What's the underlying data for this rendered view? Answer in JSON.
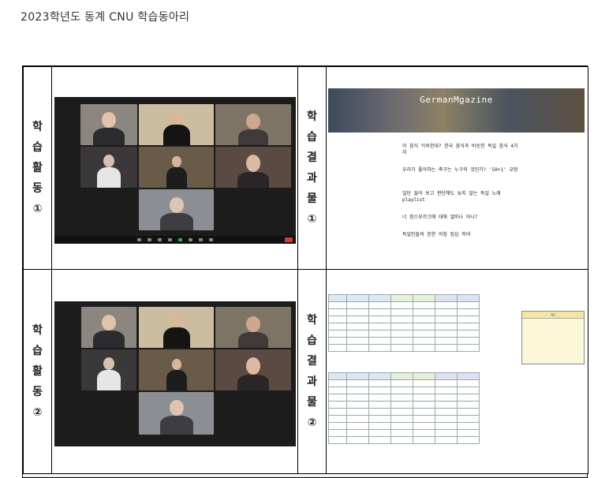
{
  "page_title": "2023학년도 동계 CNU 학습동아리",
  "rows": [
    {
      "activity_label": "학습활동①",
      "result_label": "학습결과물①",
      "activity_chars": [
        "학",
        "습",
        "활",
        "동",
        "①"
      ],
      "result_chars": [
        "학",
        "습",
        "결",
        "과",
        "물",
        "①"
      ]
    },
    {
      "activity_label": "학습활동②",
      "result_label": "학습결과물②",
      "activity_chars": [
        "학",
        "습",
        "활",
        "동",
        "②"
      ],
      "result_chars": [
        "학",
        "습",
        "결",
        "과",
        "물",
        "②"
      ]
    }
  ],
  "blog": {
    "title": "GermanMgazine",
    "posts": [
      {
        "title": "이 음식 익숙한데? 한국 음식과 비슷한 독일 음식 4가지"
      },
      {
        "title": "우리가 좋아하는 축구는 누구의 것인가? '50+1' 규정"
      },
      {
        "title": "일단 들어 보고 판단해도 늦지 않는 독일 노래 playlist"
      },
      {
        "title": "너 함스부르크에 대해 얼마나 아니?"
      },
      {
        "title": "독일인들의 흔한 아침 집십 저녁"
      }
    ]
  },
  "sheet": {
    "notes_header": "메모"
  }
}
